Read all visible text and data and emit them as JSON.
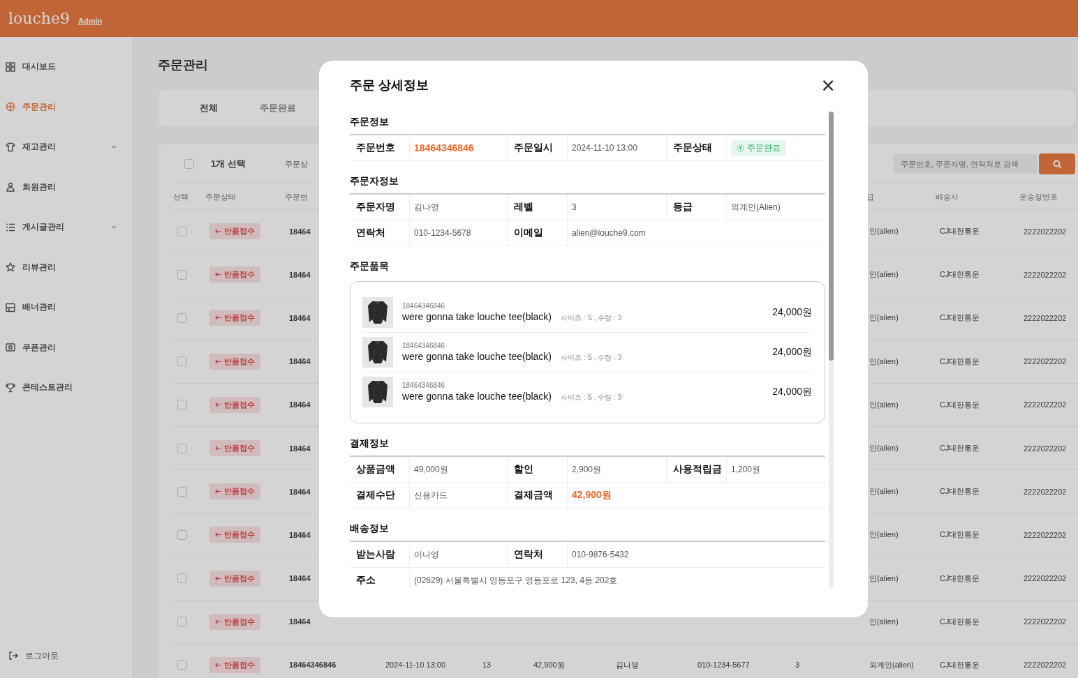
{
  "header": {
    "logo": "louche9",
    "badge": "Admin"
  },
  "sidebar": {
    "items": [
      {
        "label": "대시보드",
        "selected": false,
        "expandable": false
      },
      {
        "label": "주문관리",
        "selected": true,
        "expandable": false
      },
      {
        "label": "재고관리",
        "selected": false,
        "expandable": true
      },
      {
        "label": "회원관리",
        "selected": false,
        "expandable": false
      },
      {
        "label": "게시글관리",
        "selected": false,
        "expandable": true
      },
      {
        "label": "리뷰관리",
        "selected": false,
        "expandable": false
      },
      {
        "label": "배너관리",
        "selected": false,
        "expandable": false
      },
      {
        "label": "쿠폰관리",
        "selected": false,
        "expandable": false
      },
      {
        "label": "콘테스트관리",
        "selected": false,
        "expandable": false
      }
    ],
    "logout": "로그아웃"
  },
  "page": {
    "title": "주문관리",
    "tabs": [
      {
        "label": "전체",
        "selected": true
      },
      {
        "label": "주문완료",
        "selected": false
      }
    ],
    "toolbar": {
      "selection": "1개 선택",
      "filter": "주문상",
      "checked": false
    },
    "search": {
      "placeholder": "주문번호, 주문자명, 연락처로 검색"
    },
    "table": {
      "columns": {
        "check": "선택",
        "status": "주문상태",
        "order_no": "주문번",
        "grade": "급",
        "courier": "배송사",
        "tracking": "운송장번호"
      },
      "rows": [
        {
          "checked": false,
          "status": "반품접수",
          "order_no": "18464",
          "grade": "인(alien)",
          "courier": "CJ대한통운",
          "tracking": "2222022202"
        },
        {
          "checked": false,
          "status": "반품접수",
          "order_no": "18464",
          "grade": "인(alien)",
          "courier": "CJ대한통운",
          "tracking": "2222022202"
        },
        {
          "checked": false,
          "status": "반품접수",
          "order_no": "18464",
          "grade": "인(alien)",
          "courier": "CJ대한통운",
          "tracking": "2222022202"
        },
        {
          "checked": false,
          "status": "반품접수",
          "order_no": "18464",
          "grade": "인(alien)",
          "courier": "CJ대한통운",
          "tracking": "2222022202"
        },
        {
          "checked": false,
          "status": "반품접수",
          "order_no": "18464",
          "grade": "인(alien)",
          "courier": "CJ대한통운",
          "tracking": "2222022202"
        },
        {
          "checked": false,
          "status": "반품접수",
          "order_no": "18464",
          "grade": "인(alien)",
          "courier": "CJ대한통운",
          "tracking": "2222022202"
        },
        {
          "checked": false,
          "status": "반품접수",
          "order_no": "18464",
          "grade": "인(alien)",
          "courier": "CJ대한통운",
          "tracking": "2222022202"
        },
        {
          "checked": false,
          "status": "반품접수",
          "order_no": "18464",
          "grade": "인(alien)",
          "courier": "CJ대한통운",
          "tracking": "2222022202"
        },
        {
          "checked": false,
          "status": "반품접수",
          "order_no": "18464",
          "grade": "인(alien)",
          "courier": "CJ대한통운",
          "tracking": "2222022202"
        },
        {
          "checked": false,
          "status": "반품접수",
          "order_no": "18464",
          "grade": "인(alien)",
          "courier": "CJ대한통운",
          "tracking": "2222022202"
        },
        {
          "checked": false,
          "status": "반품접수",
          "order_no": "18464346846",
          "date": "2024-11-10 13:00",
          "qty": "13",
          "amount": "42,900원",
          "name": "김나영",
          "phone": "010-1234-5677",
          "level": "3",
          "grade": "외계인(alien)",
          "courier": "CJ대한통운",
          "tracking": "2222022202"
        }
      ]
    }
  },
  "modal": {
    "title": "주문 상세정보",
    "close": "×",
    "sections": [
      {
        "kind": "table",
        "heading": "주문정보",
        "rows": [
          [
            {
              "label": "주문번호",
              "value": "18464346846",
              "kind": "accent"
            },
            {
              "label": "주문일시",
              "value": "2024-11-10 13:00",
              "kind": "text"
            },
            {
              "label": "주문상태",
              "value": "주문완료",
              "kind": "badge"
            }
          ]
        ]
      },
      {
        "kind": "table",
        "heading": "주문자정보",
        "rows": [
          [
            {
              "label": "주문자명",
              "value": "김나영",
              "kind": "text"
            },
            {
              "label": "레벨",
              "value": "3",
              "kind": "text"
            },
            {
              "label": "등급",
              "value": "외계인(Alien)",
              "kind": "text"
            }
          ],
          [
            {
              "label": "연락처",
              "value": "010-1234-5678",
              "kind": "text"
            },
            {
              "label": "이메일",
              "value": "alien@louche9.com",
              "kind": "text"
            }
          ]
        ]
      },
      {
        "kind": "items",
        "heading": "주문품목",
        "items": [
          {
            "code": "18464346846",
            "name": "were gonna take louche tee(black)",
            "option": "사이즈 : S , 수량 : 3",
            "price": "24,000원"
          },
          {
            "code": "18464346846",
            "name": "were gonna take louche tee(black)",
            "option": "사이즈 : S , 수량 : 3",
            "price": "24,000원"
          },
          {
            "code": "18464346846",
            "name": "were gonna take louche tee(black)",
            "option": "사이즈 : S , 수량 : 3",
            "price": "24,000원"
          }
        ]
      },
      {
        "kind": "table",
        "heading": "결제정보",
        "rows": [
          [
            {
              "label": "상품금액",
              "value": "49,000원",
              "kind": "text"
            },
            {
              "label": "할인",
              "value": "2,900원",
              "kind": "text"
            },
            {
              "label": "사용적립금",
              "value": "1,200원",
              "kind": "text"
            }
          ],
          [
            {
              "label": "결제수단",
              "value": "신용카드",
              "kind": "text"
            },
            {
              "label": "결제금액",
              "value": "42,900원",
              "kind": "accent"
            }
          ]
        ]
      },
      {
        "kind": "table",
        "heading": "배송정보",
        "rows": [
          [
            {
              "label": "받는사람",
              "value": "이나영",
              "kind": "text"
            },
            {
              "label": "연락처",
              "value": "010-9876-5432",
              "kind": "text"
            }
          ],
          [
            {
              "label": "주소",
              "value": "(02629) 서울특별시 영등포구 영등포로 123, 4동 202호",
              "kind": "text",
              "span": true
            }
          ],
          []
        ]
      }
    ]
  }
}
